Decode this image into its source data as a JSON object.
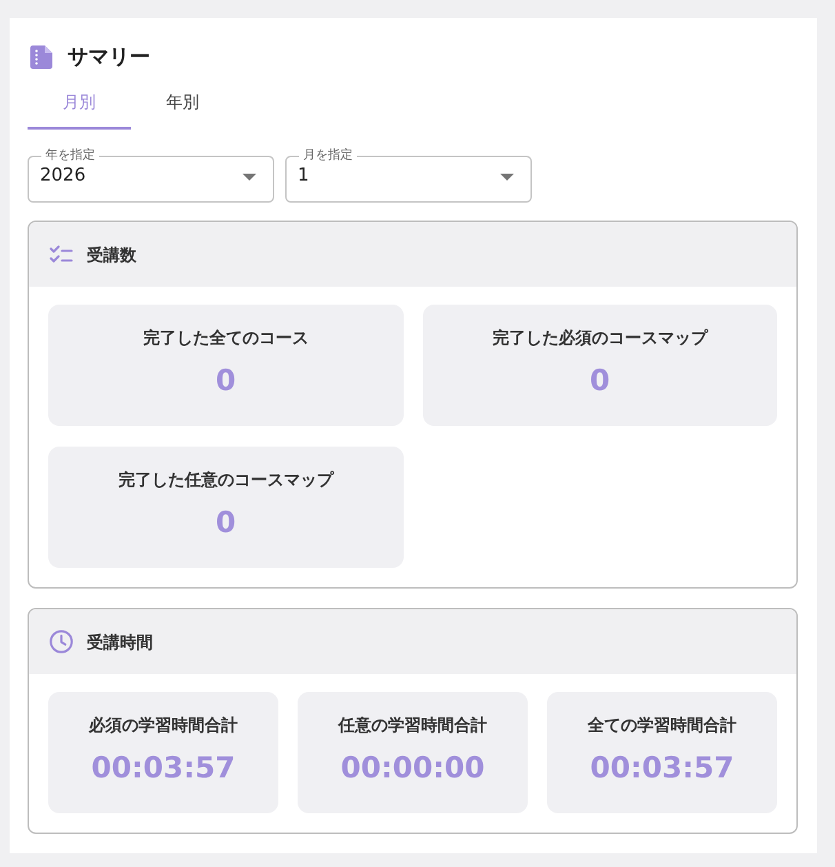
{
  "header": {
    "title": "サマリー"
  },
  "tabs": [
    {
      "label": "月別",
      "selected": true
    },
    {
      "label": "年別",
      "selected": false
    }
  ],
  "filters": [
    {
      "label": "年を指定",
      "value": "2026"
    },
    {
      "label": "月を指定",
      "value": "1"
    }
  ],
  "sections": [
    {
      "kind": "count",
      "title": "受講数",
      "stats": [
        {
          "label": "完了した全てのコース",
          "value": "0"
        },
        {
          "label": "完了した必須のコースマップ",
          "value": "0"
        },
        {
          "label": "完了した任意のコースマップ",
          "value": "0"
        }
      ]
    },
    {
      "kind": "time",
      "title": "受講時間",
      "stats": [
        {
          "label": "必須の学習時間合計",
          "value": "00:03:57"
        },
        {
          "label": "任意の学習時間合計",
          "value": "00:00:00"
        },
        {
          "label": "全ての学習時間合計",
          "value": "00:03:57"
        }
      ]
    }
  ]
}
